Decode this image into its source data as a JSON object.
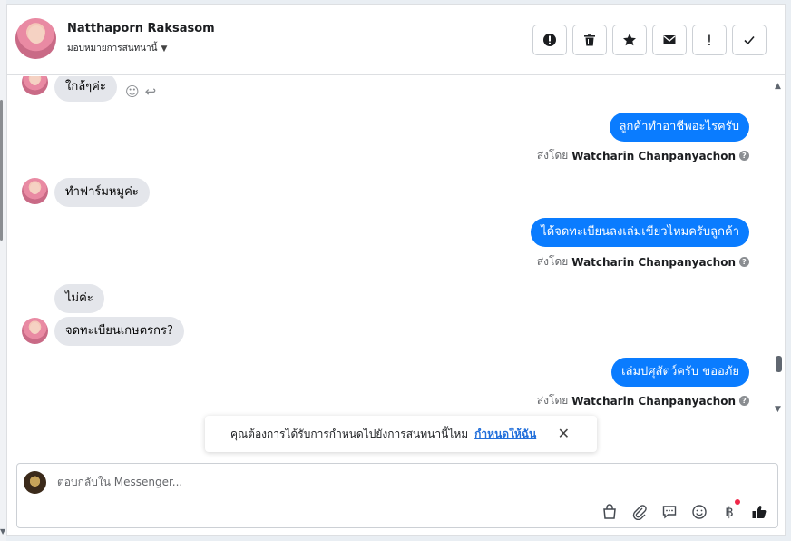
{
  "contact": {
    "name": "Natthaporn Raksasom",
    "assign_label": "มอบหมายการสนทนานี้"
  },
  "header_actions": [
    {
      "icon": "spam-icon",
      "symbol": "!"
    },
    {
      "icon": "trash-icon",
      "symbol": "🗑"
    },
    {
      "icon": "star-icon",
      "symbol": "★"
    },
    {
      "icon": "envelope-icon",
      "symbol": "✉"
    },
    {
      "icon": "exclamation-icon",
      "symbol": "!"
    },
    {
      "icon": "check-icon",
      "symbol": "✓"
    }
  ],
  "messages": {
    "in_1": "ใกล้ๆค่ะ",
    "out_1": "ลูกค้าทำอาชีพอะไรครับ",
    "in_2": "ทำฟาร์มหมูค่ะ",
    "out_2": "ได้จดทะเบียนลงเล่มเขียวไหมครับลูกค้า",
    "in_3": "ไม่ค่ะ",
    "in_4": "จดทะเบียนเกษตรกร?",
    "out_3": "เล่มปศุสัตว์ครับ ขออภัย",
    "sent_by_prefix": "ส่งโดย",
    "sender": "Watcharin Chanpanyachon",
    "help_mark": "?"
  },
  "notice": {
    "text": "คุณต้องการได้รับการกำหนดไปยังการสนทนานี้ไหม",
    "link": "กำหนดให้ฉัน",
    "close": "✕"
  },
  "composer": {
    "placeholder": "ตอบกลับใน Messenger...",
    "tools": [
      "bag-icon",
      "paperclip-icon",
      "saved-reply-icon",
      "emoji-icon",
      "baht-icon",
      "thumbs-up-icon"
    ]
  },
  "colors": {
    "outgoing_bubble": "#0a7cff",
    "incoming_bubble": "#e4e6eb",
    "link": "#216fdb",
    "notification_dot": "#f02849"
  }
}
